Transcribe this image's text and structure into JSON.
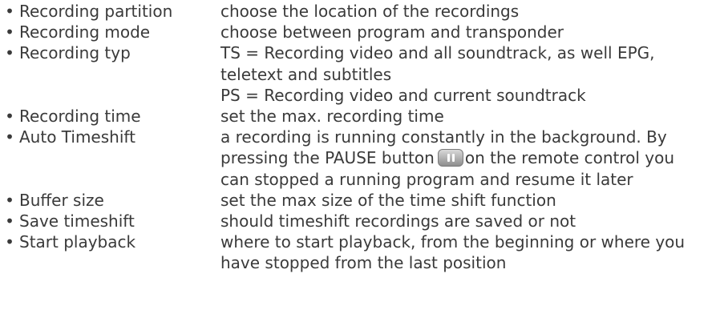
{
  "bullet": "•",
  "items": [
    {
      "term": "Recording partition",
      "lines": [
        "choose the location of the recordings"
      ]
    },
    {
      "term": "Recording mode",
      "lines": [
        "choose between program and transponder"
      ]
    },
    {
      "term": "Recording typ",
      "lines": [
        "TS = Recording video and all soundtrack, as well EPG,",
        "teletext and subtitles",
        "PS = Recording video and current soundtrack"
      ]
    },
    {
      "term": "Recording time",
      "lines": [
        "set the max. recording time"
      ]
    },
    {
      "term": "Auto Timeshift",
      "lines": [
        "a recording is running constantly in the background. By",
        "pressing the PAUSE button",
        "on the remote control you",
        "can stopped a running program and resume it later"
      ],
      "icon": "pause-button-icon"
    },
    {
      "term": "Buffer size",
      "lines": [
        "set the max size of the time shift function"
      ]
    },
    {
      "term": "Save timeshift",
      "lines": [
        "should timeshift recordings are saved or not"
      ]
    },
    {
      "term": "Start playback",
      "lines": [
        "where to start playback, from the beginning or where you",
        "have stopped from the last position"
      ]
    }
  ]
}
